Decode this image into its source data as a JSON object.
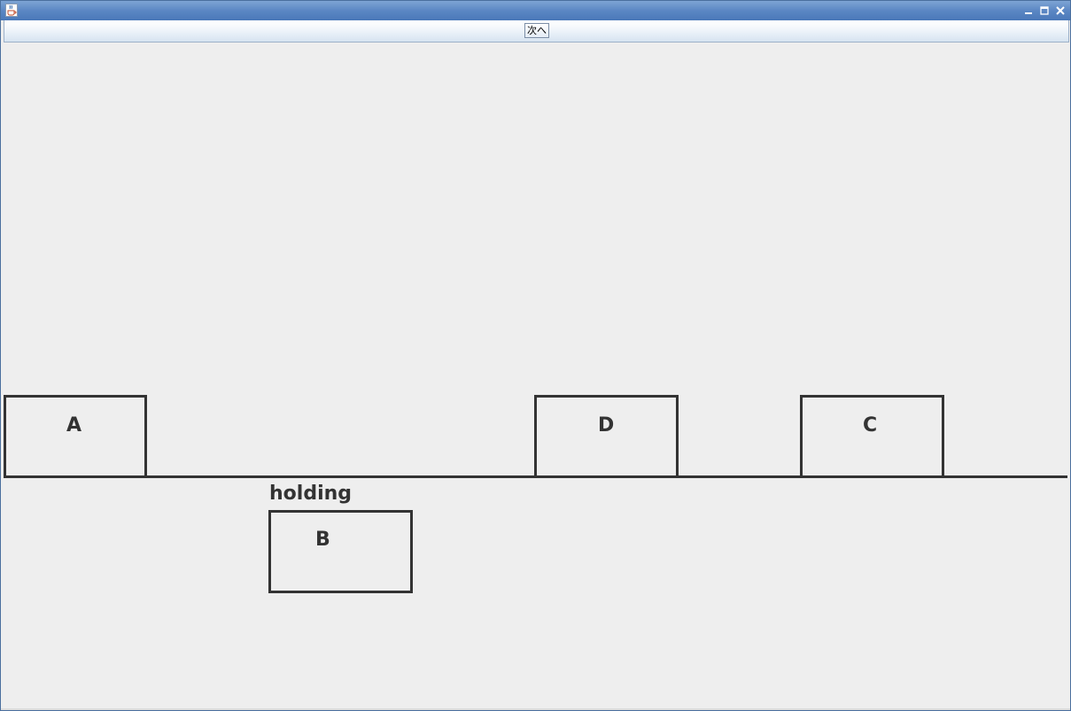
{
  "window": {
    "icon": "java-cup-icon",
    "controls": [
      "minimize-icon",
      "maximize-icon",
      "close-icon"
    ]
  },
  "toolbar": {
    "next_label": "次へ"
  },
  "scene": {
    "table_blocks": [
      "A",
      "D",
      "C"
    ],
    "holding_label": "holding",
    "held_block": "B"
  }
}
